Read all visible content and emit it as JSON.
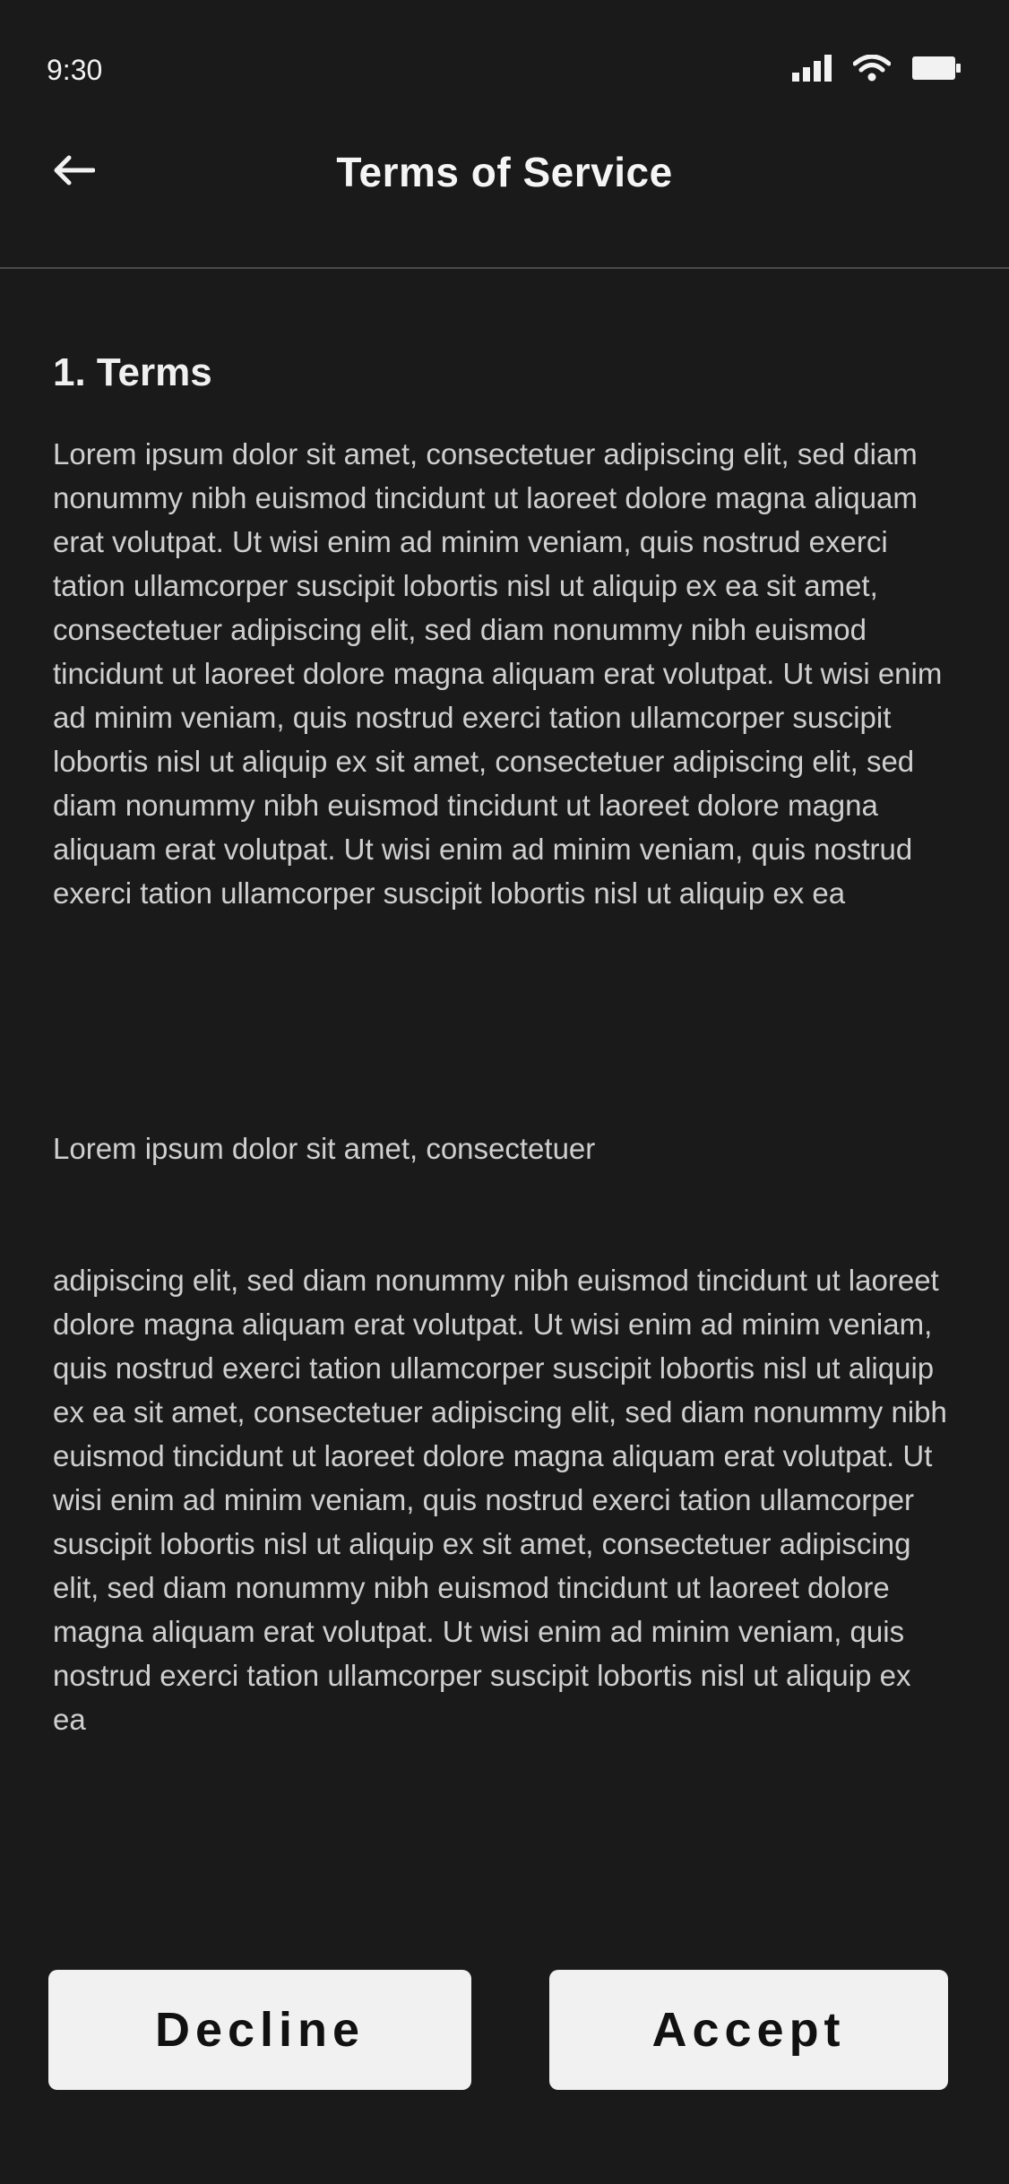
{
  "status_bar": {
    "time": "9:30",
    "icons": [
      "cellular-signal-icon",
      "wifi-icon",
      "battery-icon"
    ]
  },
  "header": {
    "back_icon": "arrow-left-icon",
    "title": "Terms of Service"
  },
  "content": {
    "section_heading": "1. Terms",
    "paragraphs": [
      "Lorem ipsum dolor sit amet, consectetuer adipiscing elit, sed diam nonummy nibh euismod tincidunt ut laoreet dolore magna aliquam erat volutpat. Ut wisi enim ad minim veniam, quis nostrud exerci tation ullamcorper suscipit lobortis nisl ut aliquip ex ea sit amet, consectetuer adipiscing elit, sed diam nonummy nibh euismod tincidunt ut laoreet dolore magna aliquam erat volutpat. Ut wisi enim ad minim veniam, quis nostrud exerci tation ullamcorper suscipit lobortis nisl ut aliquip ex sit amet, consectetuer adipiscing elit, sed diam nonummy nibh euismod tincidunt ut laoreet dolore magna aliquam erat volutpat. Ut wisi enim ad minim veniam, quis nostrud exerci tation ullamcorper suscipit lobortis nisl ut aliquip ex ea",
      "Lorem ipsum dolor sit amet, consectetuer",
      "adipiscing elit, sed diam nonummy nibh euismod tincidunt ut laoreet dolore magna aliquam erat volutpat. Ut wisi enim ad minim veniam, quis nostrud exerci tation ullamcorper suscipit lobortis nisl ut aliquip ex ea sit amet, consectetuer adipiscing elit, sed diam nonummy nibh euismod tincidunt ut laoreet dolore magna aliquam erat volutpat. Ut wisi enim ad minim veniam, quis nostrud exerci tation ullamcorper suscipit lobortis nisl ut aliquip ex sit amet, consectetuer adipiscing elit, sed diam nonummy nibh euismod tincidunt ut laoreet dolore magna aliquam erat volutpat. Ut wisi enim ad minim veniam, quis nostrud exerci tation ullamcorper suscipit lobortis nisl ut aliquip ex ea"
    ]
  },
  "actions": {
    "decline_label": "Decline",
    "accept_label": "Accept"
  },
  "colors": {
    "background": "#1a1a1b",
    "button_background": "#f1f1f1",
    "button_text": "#111111",
    "body_text": "#cfcfcf",
    "title_text": "#f5f5f5"
  }
}
